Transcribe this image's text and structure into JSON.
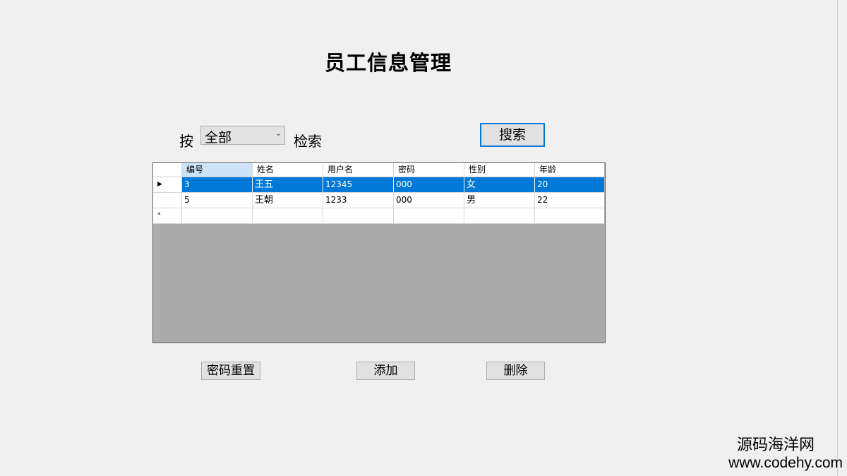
{
  "title": "员工信息管理",
  "search": {
    "prefix_label": "按",
    "selected_field": "全部",
    "suffix_label": "检索",
    "button_label": "搜索"
  },
  "grid": {
    "columns": [
      "编号",
      "姓名",
      "用户名",
      "密码",
      "性别",
      "年龄"
    ],
    "rows": [
      {
        "id": "3",
        "name": "王五",
        "username": "12345",
        "password": "000",
        "gender": "女",
        "age": "20"
      },
      {
        "id": "5",
        "name": "王朝",
        "username": "1233",
        "password": "000",
        "gender": "男",
        "age": "22"
      }
    ],
    "current_row_marker": "▶",
    "new_row_marker": "*"
  },
  "actions": {
    "reset_password": "密码重置",
    "add": "添加",
    "delete": "删除"
  },
  "watermark": {
    "name": "源码海洋网",
    "url": "www.codehy.com"
  },
  "colors": {
    "selection": "#0078d7",
    "window_bg": "#f0f0f0",
    "grid_bg": "#ababab"
  }
}
